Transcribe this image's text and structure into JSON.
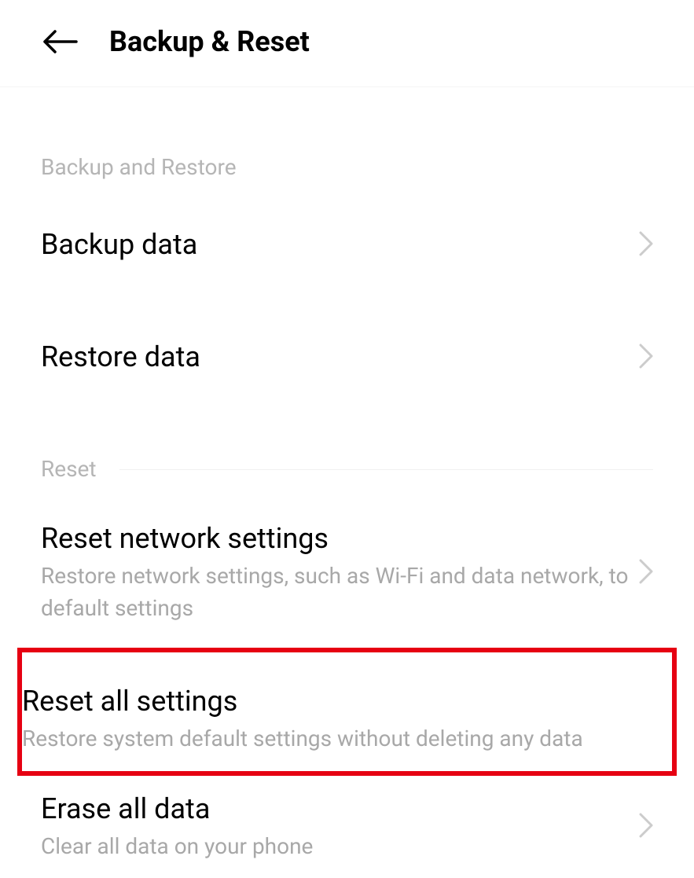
{
  "header": {
    "title": "Backup & Reset"
  },
  "sections": {
    "backup": {
      "header": "Backup and Restore",
      "items": {
        "backup_data": {
          "title": "Backup data"
        },
        "restore_data": {
          "title": "Restore data"
        }
      }
    },
    "reset": {
      "header": "Reset",
      "items": {
        "reset_network": {
          "title": "Reset network settings",
          "subtitle": "Restore network settings, such as Wi-Fi and data network, to default settings"
        },
        "reset_all": {
          "title": "Reset all settings",
          "subtitle": "Restore system default settings without deleting any data"
        },
        "erase_all": {
          "title": "Erase all data",
          "subtitle": "Clear all data on your phone"
        }
      }
    }
  }
}
